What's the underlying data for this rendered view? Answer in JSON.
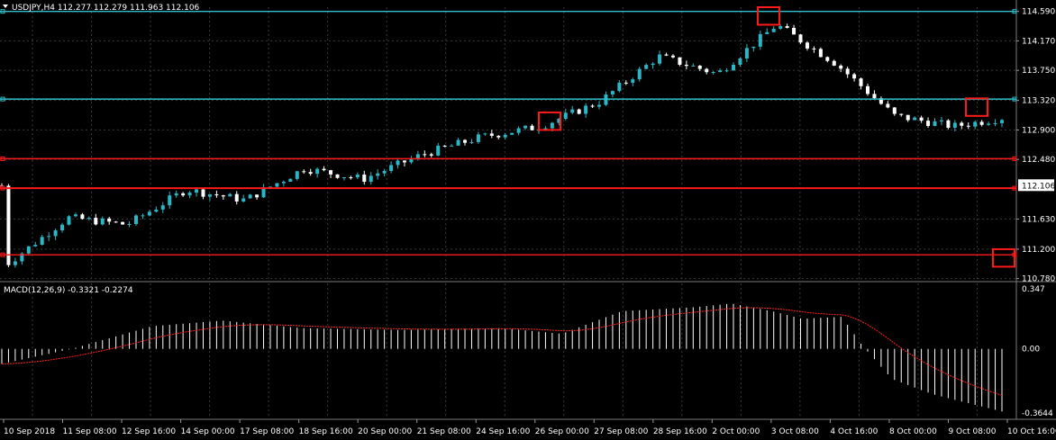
{
  "header": {
    "symbol_line": "USDJPY,H4  112.277 112.279 111.963 112.106"
  },
  "macd_header": {
    "label": "MACD(12,26,9) -0.3321 -0.2274"
  },
  "colors": {
    "background": "#000000",
    "grid": "#3a3a3a",
    "bull_candle": "#2ab6c4",
    "bear_candle": "#ffffff",
    "cyan_level": "#2fc0cc",
    "red_level": "#ff1a1a",
    "macd_hist": "#ffffff",
    "macd_signal": "#ff2020",
    "current_price_tag": "#ffffff"
  },
  "chart_data": {
    "type": "candlestick",
    "symbol": "USDJPY",
    "timeframe": "H4",
    "price_axis": {
      "ticks": [
        "114.590",
        "114.170",
        "113.750",
        "113.320",
        "112.900",
        "112.480",
        "112.106",
        "111.630",
        "111.200",
        "110.780"
      ],
      "ylim": [
        110.75,
        114.65
      ]
    },
    "current_price": "112.106",
    "x_ticks": [
      "10 Sep 2018",
      "11 Sep 08:00",
      "12 Sep 16:00",
      "14 Sep 00:00",
      "17 Sep 08:00",
      "18 Sep 16:00",
      "20 Sep 00:00",
      "21 Sep 08:00",
      "24 Sep 16:00",
      "26 Sep 00:00",
      "27 Sep 08:00",
      "28 Sep 16:00",
      "2 Oct 00:00",
      "3 Oct 08:00",
      "4 Oct 16:00",
      "8 Oct 00:00",
      "9 Oct 08:00",
      "10 Oct 16:00"
    ],
    "horizontal_levels": [
      {
        "price": 114.59,
        "color": "cyan"
      },
      {
        "price": 113.34,
        "color": "cyan"
      },
      {
        "price": 112.49,
        "color": "red"
      },
      {
        "price": 112.07,
        "color": "red"
      },
      {
        "price": 111.12,
        "color": "red"
      }
    ],
    "highlight_boxes": [
      {
        "near": "26 Sep 00:00",
        "price_range": [
          112.9,
          113.15
        ]
      },
      {
        "near": "3 Oct 08:00",
        "price_range": [
          114.4,
          114.65
        ]
      },
      {
        "near": "10 Oct 00:00",
        "price_range": [
          113.1,
          113.35
        ]
      },
      {
        "near": "10 Oct 16:00",
        "price_range": [
          110.95,
          111.2
        ]
      }
    ],
    "close_path": [
      {
        "x": "10 Sep 2018",
        "close": 110.95
      },
      {
        "x": "11 Sep 08:00",
        "close": 111.65
      },
      {
        "x": "12 Sep 16:00",
        "close": 111.55
      },
      {
        "x": "14 Sep 00:00",
        "close": 112.05
      },
      {
        "x": "17 Sep 08:00",
        "close": 111.9
      },
      {
        "x": "18 Sep 16:00",
        "close": 112.35
      },
      {
        "x": "20 Sep 00:00",
        "close": 112.2
      },
      {
        "x": "21 Sep 08:00",
        "close": 112.55
      },
      {
        "x": "24 Sep 16:00",
        "close": 112.8
      },
      {
        "x": "26 Sep 00:00",
        "close": 112.95
      },
      {
        "x": "27 Sep 08:00",
        "close": 113.3
      },
      {
        "x": "28 Sep 16:00",
        "close": 113.95
      },
      {
        "x": "2 Oct 00:00",
        "close": 113.7
      },
      {
        "x": "3 Oct 08:00",
        "close": 114.4
      },
      {
        "x": "4 Oct 16:00",
        "close": 113.85
      },
      {
        "x": "8 Oct 00:00",
        "close": 113.1
      },
      {
        "x": "9 Oct 08:00",
        "close": 112.95
      },
      {
        "x": "10 Oct 00:00",
        "close": 113.1
      },
      {
        "x": "10 Oct 16:00",
        "close": 112.106
      }
    ],
    "macd": {
      "name": "MACD(12,26,9)",
      "main": -0.3321,
      "signal": -0.2274,
      "axis_ticks": [
        "0.347",
        "0.00",
        "-0.3644"
      ],
      "ylim": [
        -0.3644,
        0.347
      ]
    }
  }
}
